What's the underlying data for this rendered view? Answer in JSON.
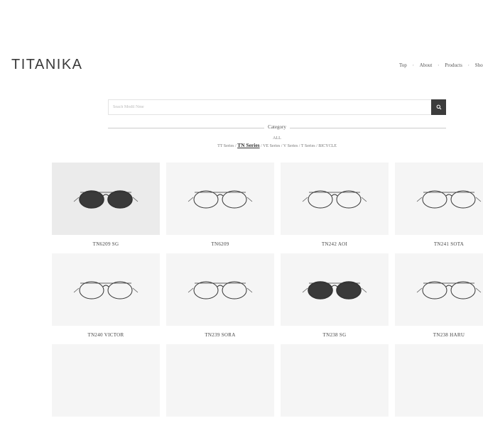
{
  "brand": {
    "logo": "TITANIKA"
  },
  "nav": {
    "items": [
      "Top",
      "About",
      "Products",
      "Shop"
    ]
  },
  "search": {
    "placeholder": "Seach Modil Nme"
  },
  "category": {
    "heading": "Category",
    "all_label": "ALL",
    "filters": [
      "TT Series",
      "TN Series",
      "VE Series",
      "V Series",
      "T Series",
      "BICYCLE"
    ],
    "active": "TN Series"
  },
  "products": [
    {
      "name": "TN6209 SG",
      "bg": "#ebebeb",
      "tinted": true
    },
    {
      "name": "TN6209",
      "bg": "#f5f5f5",
      "tinted": false
    },
    {
      "name": "TN242 AOI",
      "bg": "#f5f5f5",
      "tinted": false
    },
    {
      "name": "TN241 SOTA",
      "bg": "#f5f5f5",
      "tinted": false
    },
    {
      "name": "TN240 VICTOR",
      "bg": "#f5f5f5",
      "tinted": false
    },
    {
      "name": "TN239 SORA",
      "bg": "#f5f5f5",
      "tinted": false
    },
    {
      "name": "TN238 SG",
      "bg": "#f5f5f5",
      "tinted": true
    },
    {
      "name": "TN238 HARU",
      "bg": "#f5f5f5",
      "tinted": false
    },
    {
      "name": "",
      "bg": "#f5f5f5",
      "tinted": false
    },
    {
      "name": "",
      "bg": "#f5f5f5",
      "tinted": false
    },
    {
      "name": "",
      "bg": "#f5f5f5",
      "tinted": false
    },
    {
      "name": "",
      "bg": "#f5f5f5",
      "tinted": false
    }
  ],
  "colors": {
    "search_button": "#3c3c3c",
    "lens_tint": "#3a3a3a"
  }
}
